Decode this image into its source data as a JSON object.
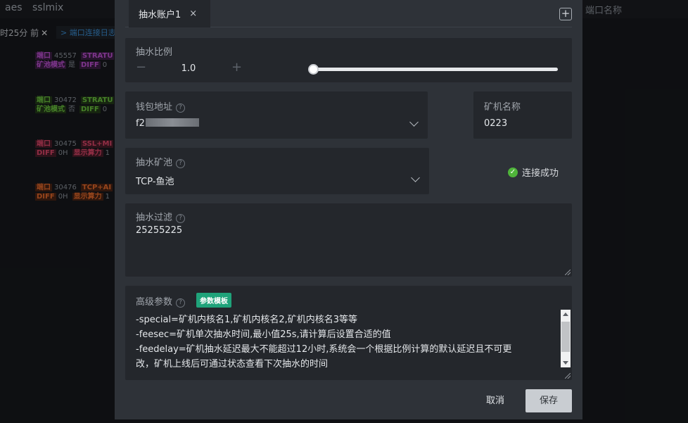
{
  "background": {
    "nav": [
      "aes",
      "sslmix"
    ],
    "tab_time": "时25分 前",
    "tab_close": "✕",
    "tab_link": "> 端口连接日志",
    "right_label": "端口名称",
    "rows": [
      {
        "l1_tag": "端口",
        "l1_val": "45557",
        "l1_tag2": "STRATU",
        "l2_tag": "矿池模式",
        "l2_val": "是",
        "l2_tag2": "DIFF",
        "l2_val2": "0",
        "color": "purple"
      },
      {
        "l1_tag": "端口",
        "l1_val": "30472",
        "l1_tag2": "STRATU",
        "l2_tag": "矿池模式",
        "l2_val": "否",
        "l2_tag2": "DIFF",
        "l2_val2": "0",
        "color": "green"
      },
      {
        "l1_tag": "端口",
        "l1_val": "30475",
        "l1_tag2": "SSL+MI",
        "l2_tag": "DIFF",
        "l2_val": "0H",
        "l2_tag2": "显示算力",
        "l2_val2": "1",
        "color": "red"
      },
      {
        "l1_tag": "端口",
        "l1_val": "30476",
        "l1_tag2": "TCP+AI",
        "l2_tag": "DIFF",
        "l2_val": "0H",
        "l2_tag2": "显示算力",
        "l2_val2": "1",
        "color": "orange"
      }
    ]
  },
  "dialog": {
    "tab_label": "抽水账户1",
    "tab_close": "×",
    "add_tab": "+",
    "ratio": {
      "label": "抽水比例",
      "minus": "−",
      "value": "1.0",
      "plus": "+",
      "slider_fraction": 0.0
    },
    "wallet": {
      "label": "钱包地址",
      "value_prefix": "f2"
    },
    "miner_name": {
      "label": "矿机名称",
      "value": "0223"
    },
    "pool": {
      "label": "抽水矿池",
      "value": "TCP-鱼池"
    },
    "status": {
      "text": "连接成功",
      "icon": "check-circle-icon",
      "color": "#4fb43a"
    },
    "filter": {
      "label": "抽水过滤",
      "value": "25255225"
    },
    "advanced": {
      "label": "高级参数",
      "badge": "参数模板",
      "lines": [
        "-special=矿机内核名1,矿机内核名2,矿机内核名3等等",
        "-feesec=矿机单次抽水时间,最小值25s,请计算后设置合适的值",
        "-feedelay=矿机抽水延迟最大不能超过12小时,系统会一个根据比例计算的默认延迟且不可更",
        "改，矿机上线后可通过状态查看下次抽水的时间"
      ]
    },
    "help_glyph": "?",
    "cancel_label": "取消",
    "save_label": "保存"
  }
}
